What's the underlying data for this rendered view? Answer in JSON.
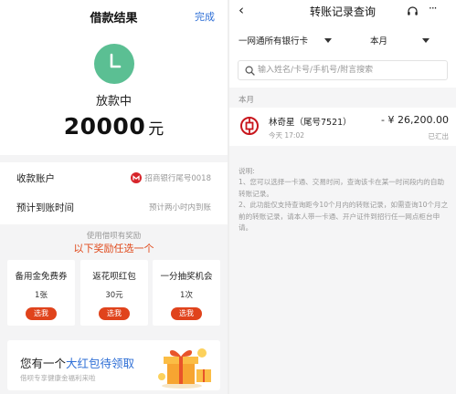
{
  "left": {
    "title": "借款结果",
    "done_label": "完成",
    "status": "放款中",
    "amount": "20000",
    "amount_unit": "元",
    "status_color": "#5bbf93",
    "account_label": "收款账户",
    "account_value": "招商银行尾号0018",
    "eta_label": "预计到账时间",
    "eta_value": "预计两小时内到账",
    "promo_subtitle": "使用借呗有奖励",
    "promo_title": "以下奖励任选一个",
    "coupons": [
      {
        "name": "备用金免费券",
        "qty": "1张",
        "button": "选我"
      },
      {
        "name": "返花呗红包",
        "qty": "30元",
        "button": "选我"
      },
      {
        "name": "一分抽奖机会",
        "qty": "1次",
        "button": "选我"
      }
    ],
    "banner_title_a": "您有一个",
    "banner_title_b": "大红包待领取",
    "banner_sub": "借呗专享健康金福利来啦",
    "accent_color": "#e0431c",
    "link_color": "#2f6fd6"
  },
  "right": {
    "back_icon": "chevron-left-icon",
    "title": "转账记录查询",
    "filter_bank": "一网通所有银行卡",
    "filter_period": "本月",
    "search_placeholder": "输入姓名/卡号/手机号/附言搜索",
    "month_label": "本月",
    "transactions": [
      {
        "name": "林奇星（尾号7521）",
        "time": "今天 17:02",
        "amount": "- ¥ 26,200.00",
        "status": "已汇出"
      }
    ],
    "note_title": "说明:",
    "note_1": "1、您可以选择一卡通、交易时间，查询该卡在某一时间段内的自助转账记录。",
    "note_2": "2、此功能仅支持查询距今10个月内的转账记录，如需查询10个月之前的转账记录，请本人带一卡通、开户证件到招行任一网点柜台申请。"
  }
}
